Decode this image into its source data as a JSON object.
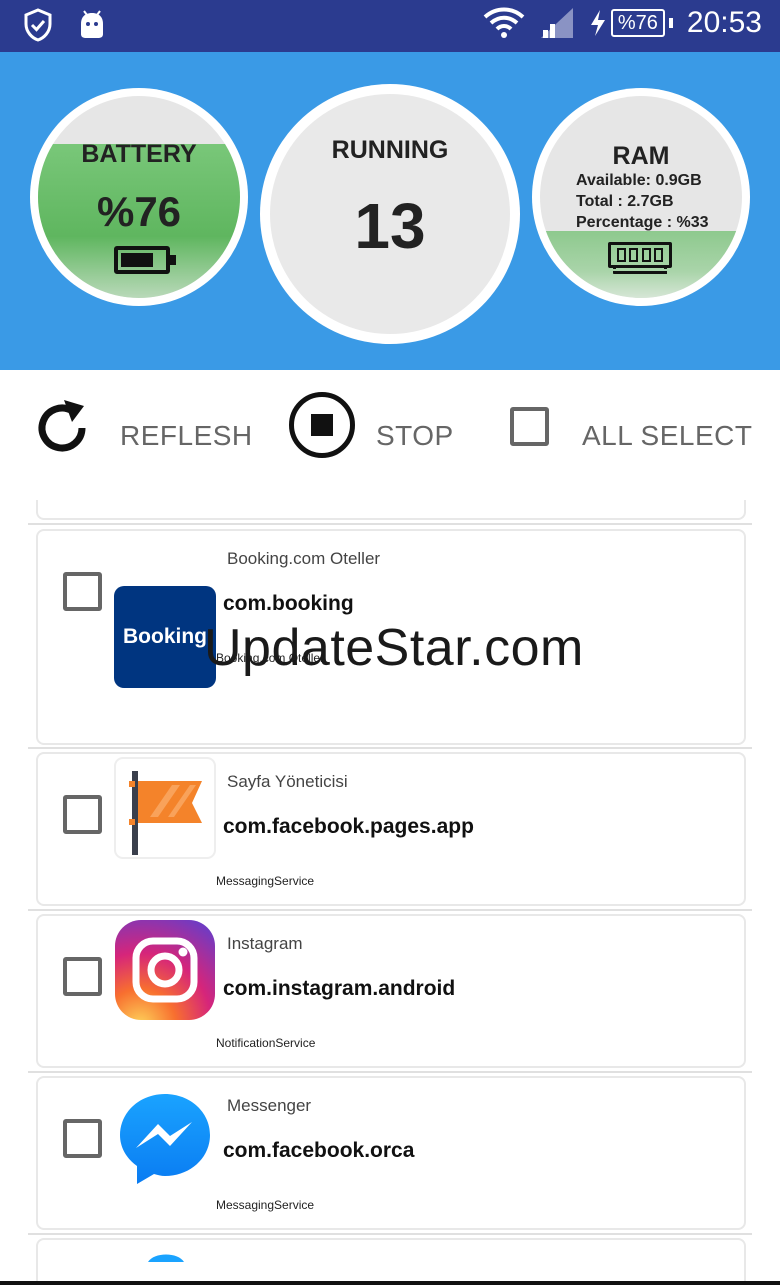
{
  "status_bar": {
    "time": "20:53",
    "battery": "%76"
  },
  "gauges": {
    "battery": {
      "title": "BATTERY",
      "value": "%76",
      "level_fraction": 0.76
    },
    "running": {
      "title": "RUNNING",
      "value": "13"
    },
    "ram": {
      "title": "RAM",
      "available": "Available: 0.9GB",
      "total": "Total : 2.7GB",
      "percentage": "Percentage : %33",
      "level_fraction": 0.33
    }
  },
  "actions": {
    "refresh_label": "REFLESH",
    "stop_label": "STOP",
    "all_select_label": "ALL SELECT"
  },
  "apps": [
    {
      "name": "Booking.com Oteller",
      "package": "com.booking",
      "service": "Booking.com Oteller",
      "icon": "booking-icon",
      "icon_text": "Booking"
    },
    {
      "name": "Sayfa Yöneticisi",
      "package": "com.facebook.pages.app",
      "service": "MessagingService",
      "icon": "pages-manager-icon"
    },
    {
      "name": "Instagram",
      "package": "com.instagram.android",
      "service": "NotificationService",
      "icon": "instagram-icon"
    },
    {
      "name": "Messenger",
      "package": "com.facebook.orca",
      "service": "MessagingService",
      "icon": "messenger-icon"
    }
  ],
  "watermark": "UpdateStar.com",
  "colors": {
    "status_bar": "#2b3b8f",
    "header": "#3a9ae6",
    "battery_fill": "#6bbf6b",
    "ram_fill": "#9ccf9c",
    "booking_blue": "#003580"
  }
}
